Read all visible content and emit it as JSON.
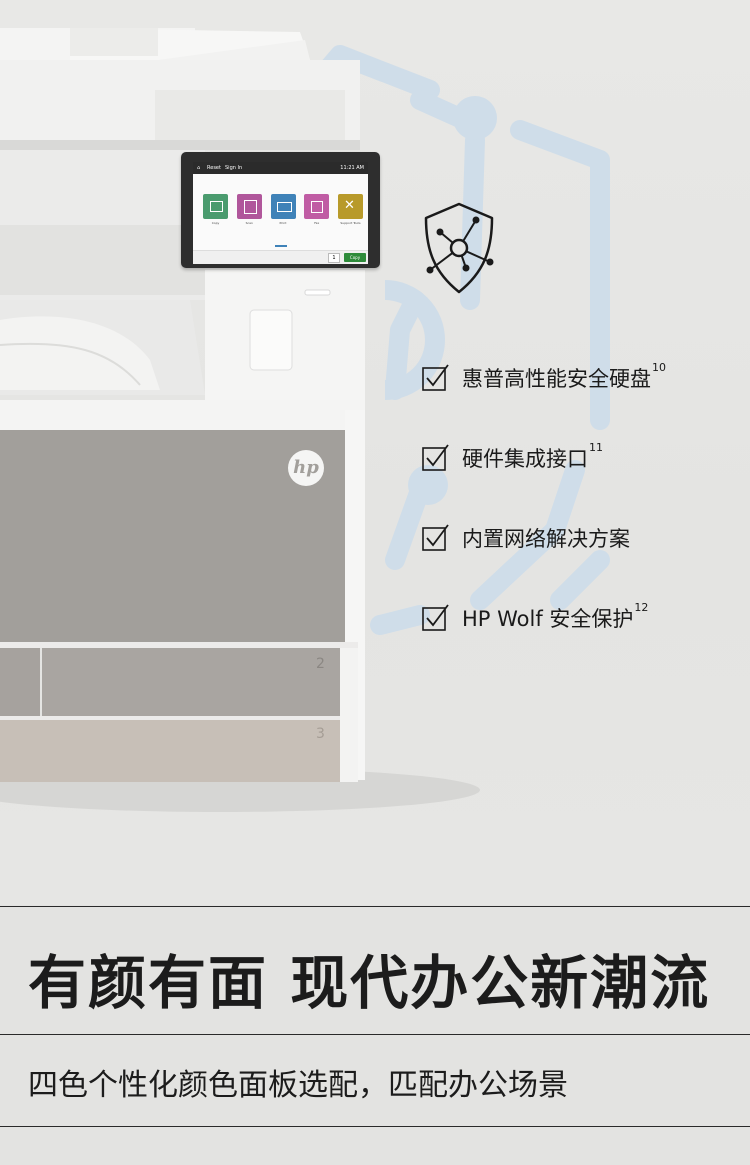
{
  "printer": {
    "brand_logo_text": "hp",
    "tray_labels": [
      "2",
      "3"
    ],
    "screen": {
      "top_left_items": [
        "Reset",
        "Sign In"
      ],
      "clock": "11:21 AM",
      "apps": [
        {
          "label": "Copy",
          "icon": "copy-app-icon",
          "color": "#4a9b6e"
        },
        {
          "label": "Scan",
          "icon": "scan-app-icon",
          "color": "#b0569b"
        },
        {
          "label": "Print",
          "icon": "print-app-icon",
          "color": "#3f82b8"
        },
        {
          "label": "Fax",
          "icon": "fax-app-icon",
          "color": "#c05ca4"
        },
        {
          "label": "Support Tools",
          "icon": "tools-app-icon",
          "color": "#b89a2a"
        }
      ],
      "copy_count": "1",
      "copy_button": "Copy"
    }
  },
  "security_icon": "shield-network-icon",
  "features": [
    {
      "text": "惠普高性能安全硬盘",
      "sup": "10",
      "icon": "checkbox-checked-icon"
    },
    {
      "text": "硬件集成接口",
      "sup": "11",
      "icon": "checkbox-checked-icon"
    },
    {
      "text": "内置网络解决方案",
      "sup": "",
      "icon": "checkbox-checked-icon"
    },
    {
      "text": "HP Wolf 安全保护",
      "sup": "12",
      "icon": "checkbox-checked-icon"
    }
  ],
  "headline": "有颜有面 现代办公新潮流",
  "subline": "四色个性化颜色面板选配，匹配办公场景",
  "colors": {
    "background": "#e3e3e1",
    "network_lines": "#c9d9e6",
    "panel_gray": "#a09d99",
    "tray3": "#c6beb6",
    "text": "#1c1c1c"
  }
}
